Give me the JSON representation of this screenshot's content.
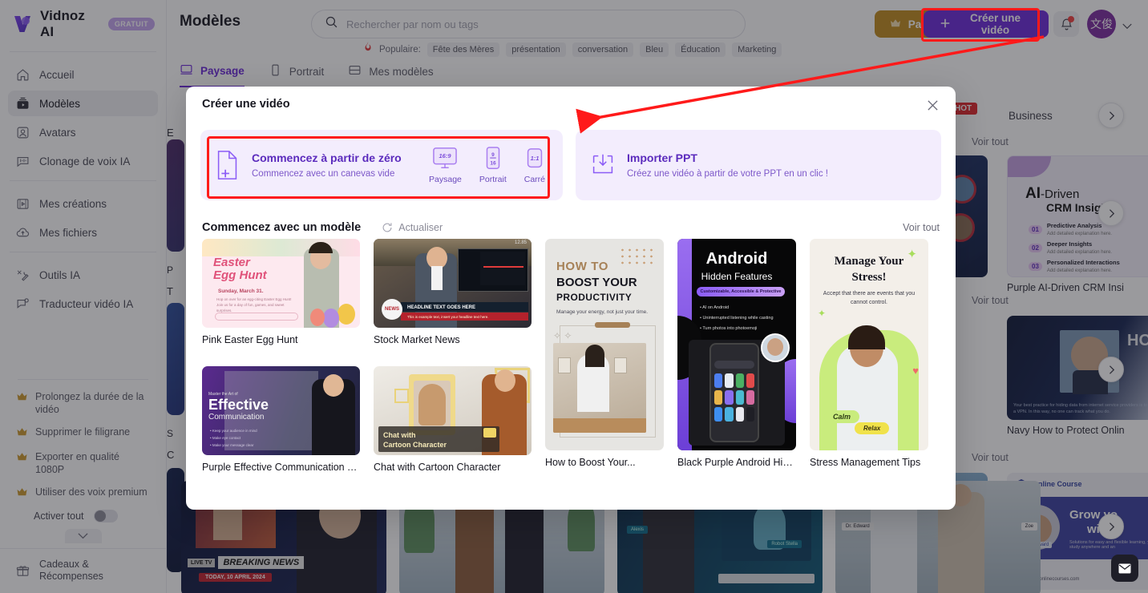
{
  "app": {
    "brand": "Vidnoz AI",
    "brand_badge": "GRATUIT",
    "page_title": "Modèles"
  },
  "sidebar": {
    "items": [
      {
        "label": "Accueil",
        "icon": "home-icon",
        "active": false
      },
      {
        "label": "Modèles",
        "icon": "templates-icon",
        "active": true
      },
      {
        "label": "Avatars",
        "icon": "avatar-icon",
        "active": false
      },
      {
        "label": "Clonage de voix IA",
        "icon": "voice-clone-icon",
        "active": false
      }
    ],
    "items2": [
      {
        "label": "Mes créations",
        "icon": "my-creations-icon"
      },
      {
        "label": "Mes fichiers",
        "icon": "my-files-icon"
      }
    ],
    "items3": [
      {
        "label": "Outils IA",
        "icon": "ai-tools-icon"
      },
      {
        "label": "Traducteur vidéo IA",
        "icon": "video-translator-icon"
      }
    ],
    "premium": [
      "Prolongez la durée de la vidéo",
      "Supprimer le filigrane",
      "Exporter en qualité 1080P",
      "Utiliser des voix premium"
    ],
    "activate_all": "Activer tout",
    "gifts": "Cadeaux & Récompenses"
  },
  "search": {
    "placeholder": "Rechercher par nom ou tags",
    "value": "",
    "popular_label": "Populaire:",
    "tags": [
      "Fête des Mères",
      "présentation",
      "conversation",
      "Bleu",
      "Éducation",
      "Marketing"
    ]
  },
  "topbar": {
    "pro_button": "Passer PRO",
    "create_button": "Créer une vidéo",
    "avatar_initials": "文俊"
  },
  "tabs": [
    {
      "label": "Paysage",
      "icon": "landscape-icon",
      "active": true
    },
    {
      "label": "Portrait",
      "icon": "portrait-icon",
      "active": false
    },
    {
      "label": "Mes modèles",
      "icon": "my-templates-icon",
      "active": false
    }
  ],
  "background": {
    "hot_badge": "HOT",
    "business_label": "Business",
    "voir_tout": "Voir tout",
    "right_cards": [
      {
        "label": "Purple AI-Driven CRM Insi"
      },
      {
        "label": "Navy How to Protect Onlin"
      }
    ],
    "left_letters": [
      "E",
      "P",
      "T",
      "S",
      "C"
    ]
  },
  "modal": {
    "title": "Créer une vidéo",
    "close_icon": "close-icon",
    "scratch": {
      "title": "Commencez à partir de zéro",
      "subtitle": "Commencez avec un canevas vide",
      "ratios": [
        {
          "label": "Paysage",
          "ratio": "16:9"
        },
        {
          "label": "Portrait",
          "ratio": "9/16"
        },
        {
          "label": "Carré",
          "ratio": "1:1"
        }
      ]
    },
    "ppt": {
      "title": "Importer PPT",
      "subtitle": "Créez une vidéo à partir de votre PPT en un clic !"
    },
    "templates_section": {
      "title": "Commencez avec un modèle",
      "refresh": "Actualiser",
      "voir_tout": "Voir tout"
    },
    "templates": [
      {
        "label": "Pink Easter Egg Hunt",
        "art": "easter"
      },
      {
        "label": "Stock Market News",
        "art": "stock"
      },
      {
        "label": "Purple Effective Communication Tips",
        "art": "effective"
      },
      {
        "label": "Chat with Cartoon Character",
        "art": "cartoon"
      },
      {
        "label": "How to Boost Your...",
        "art": "boost"
      },
      {
        "label": "Black Purple Android Hidde...",
        "art": "android"
      },
      {
        "label": "Stress Management Tips",
        "art": "stress"
      }
    ],
    "template_art_text": {
      "easter_title": "Easter\nEgg Hunt",
      "easter_sub": "Sunday, March 31.",
      "stock_headline": "HEADLINE TEXT GOES HERE",
      "stock_badge": "NEWS",
      "effective_small": "Master the Art of",
      "effective_title": "Effective",
      "effective_sub": "Communication",
      "cartoon_line1": "Chat with",
      "cartoon_line2": "Cartoon Character",
      "boost_l1": "HOW TO",
      "boost_l2": "BOOST YOUR",
      "boost_l3": "PRODUCTIVITY",
      "boost_sub": "Manage your energy, not just your time.",
      "android_l1": "Android",
      "android_l2": "Hidden Features",
      "android_pill": "Customizable, Accessible & Protective",
      "android_b1": "AI on Android",
      "android_b2": "Uninterrupted listening while casting",
      "android_b3": "Turn photos into photoemoji",
      "stress_l1": "Manage Your",
      "stress_l2": "Stress!",
      "stress_sub": "Accept that there are events that you cannot control.",
      "stress_tag1": "Calm",
      "stress_tag2": "Relax"
    }
  },
  "annotations": {
    "accent_color": "#ff1a1a"
  },
  "colors": {
    "brand_purple": "#6b28d9",
    "pro_gold": "#c08a1e",
    "modal_option_bg": "#f3edfd",
    "hot_red": "#e0262a"
  }
}
